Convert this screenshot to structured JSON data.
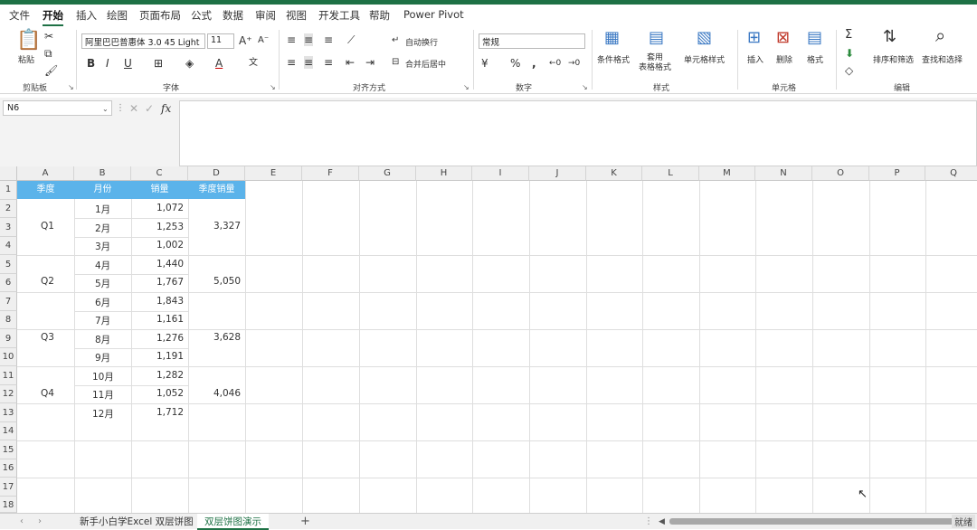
{
  "menu": {
    "items": [
      "文件",
      "开始",
      "插入",
      "绘图",
      "页面布局",
      "公式",
      "数据",
      "审阅",
      "视图",
      "开发工具",
      "帮助",
      "Power Pivot"
    ],
    "active": "开始"
  },
  "ribbon": {
    "font_name": "阿里巴巴普惠体 3.0 45 Light",
    "font_size": "11",
    "number_format": "常规",
    "groups": {
      "clipboard": "剪贴板",
      "font": "字体",
      "alignment": "对齐方式",
      "number": "数字",
      "styles": "样式",
      "cells": "单元格",
      "editing": "编辑"
    },
    "labels": {
      "paste": "粘贴",
      "wrap_text": "自动换行",
      "merge_center": "合并后居中",
      "conditional_format": "条件格式",
      "table_format": "套用\n表格格式",
      "cell_styles": "单元格样式",
      "insert": "插入",
      "delete": "删除",
      "format": "格式",
      "sort_filter": "排序和筛选",
      "find_select": "查找和选择"
    }
  },
  "formula_bar": {
    "name_box": "N6",
    "formula": ""
  },
  "sheet": {
    "columns": [
      "A",
      "B",
      "C",
      "D",
      "E",
      "F",
      "G",
      "H",
      "I",
      "J",
      "K",
      "L",
      "M",
      "N",
      "O",
      "P",
      "Q"
    ],
    "rows": [
      "1",
      "2",
      "3",
      "4",
      "5",
      "6",
      "7",
      "8",
      "9",
      "10",
      "11",
      "12",
      "13",
      "14",
      "15",
      "16",
      "17",
      "18"
    ],
    "headers": [
      "季度",
      "月份",
      "销量",
      "季度销量"
    ],
    "months": [
      "1月",
      "2月",
      "3月",
      "4月",
      "5月",
      "6月",
      "7月",
      "8月",
      "9月",
      "10月",
      "11月",
      "12月"
    ],
    "sales": [
      "1,072",
      "1,253",
      "1,002",
      "1,440",
      "1,767",
      "1,843",
      "1,161",
      "1,276",
      "1,191",
      "1,282",
      "1,052",
      "1,712"
    ],
    "quarters": [
      "Q1",
      "Q2",
      "Q3",
      "Q4"
    ],
    "quarter_totals": [
      "3,327",
      "5,050",
      "3,628",
      "4,046"
    ]
  },
  "tabs": {
    "items": [
      "新手小白学Excel  双层饼图",
      "双层饼图演示"
    ],
    "active_index": 1,
    "add": "+",
    "status": "就绪"
  },
  "colors": {
    "accent": "#1e7145",
    "header_fill": "#5bb3ea"
  }
}
